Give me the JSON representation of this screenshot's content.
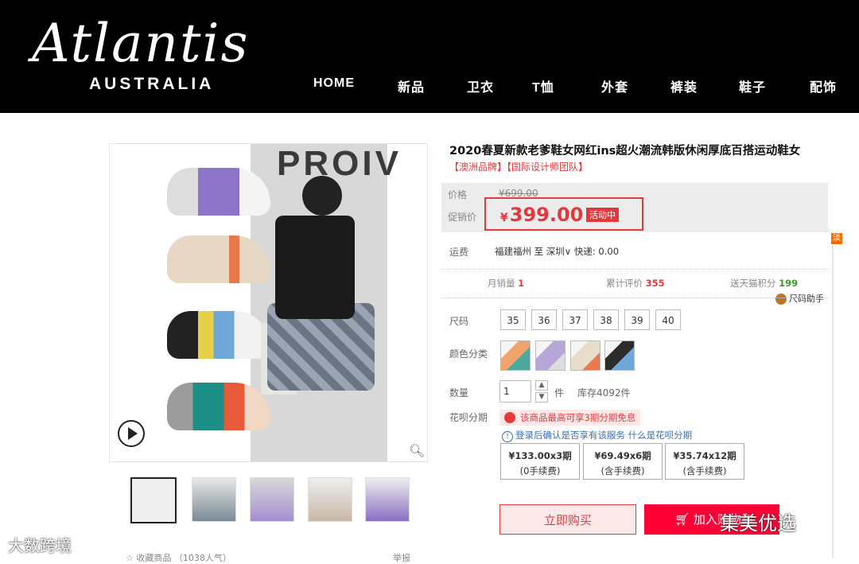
{
  "brand": {
    "script": "Atlantis",
    "sub": "AUSTRALIA"
  },
  "nav": [
    "HOME",
    "新品",
    "卫衣",
    "T恤",
    "外套",
    "裤装",
    "鞋子",
    "配饰"
  ],
  "product": {
    "title": "2020春夏新款老爹鞋女网红ins超火潮流韩版休闲厚底百搭运动鞋女",
    "tagline": "【澳洲品牌】【国际设计师团队】",
    "image_text": "PROIV"
  },
  "price": {
    "label": "价格",
    "original": "¥699.00",
    "promo_label": "促销价",
    "currency": "¥",
    "promo": "399.00",
    "badge": "活动中"
  },
  "shipping": {
    "label": "运费",
    "info": "福建福州 至 深圳∨ 快递: 0.00"
  },
  "stats": {
    "monthly_label": "月销量",
    "monthly_value": "1",
    "reviews_label": "累计评价",
    "reviews_value": "355",
    "points_label": "送天猫积分",
    "points_value": "199"
  },
  "size_helper": "尺码助手",
  "sizes": {
    "label": "尺码",
    "options": [
      "35",
      "36",
      "37",
      "38",
      "39",
      "40"
    ]
  },
  "color": {
    "label": "颜色分类",
    "swatches": [
      "#f2c9a8",
      "#b8a6d9",
      "#e8dccb",
      "#2c2c2c"
    ]
  },
  "quantity": {
    "label": "数量",
    "value": "1",
    "unit": "件",
    "stock": "库存4092件"
  },
  "installment": {
    "label": "花呗分期",
    "note": "该商品最高可享3期分期免息",
    "login_note": "登录后确认是否享有该服务",
    "link": "什么是花呗分期",
    "plans": [
      {
        "price": "¥133.00x3期",
        "fee": "(0手续费)"
      },
      {
        "price": "¥69.49x6期",
        "fee": "(含手续费)"
      },
      {
        "price": "¥35.74x12期",
        "fee": "(含手续费)"
      }
    ]
  },
  "actions": {
    "buy_now": "立即购买",
    "add_cart": "加入购物车"
  },
  "side_tag": "淡",
  "watermarks": {
    "right": "集美优选",
    "left": "大数跨境"
  },
  "bottom": {
    "fav": "☆ 收藏商品 （1038人气）",
    "right": "举报"
  }
}
